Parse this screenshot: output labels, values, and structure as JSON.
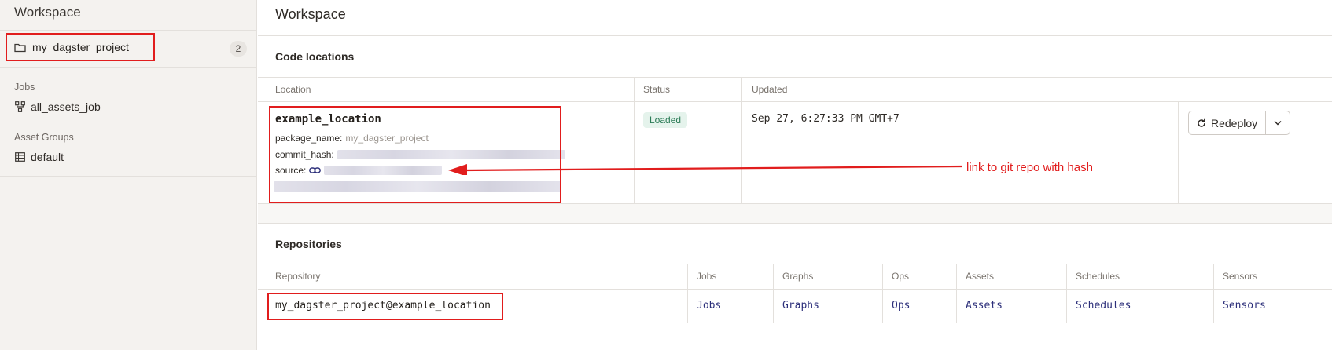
{
  "sidebar": {
    "title": "Workspace",
    "location": {
      "name": "my_dagster_project",
      "count": "2"
    },
    "jobs_label": "Jobs",
    "jobs": [
      "all_assets_job"
    ],
    "asset_groups_label": "Asset Groups",
    "asset_groups": [
      "default"
    ]
  },
  "main": {
    "title": "Workspace",
    "code_locations": {
      "title": "Code locations",
      "headers": {
        "location": "Location",
        "status": "Status",
        "updated": "Updated"
      },
      "row": {
        "name": "example_location",
        "package_key": "package_name:",
        "package_value": "my_dagster_project",
        "commit_key": "commit_hash:",
        "source_key": "source:",
        "status": "Loaded",
        "updated": "Sep 27, 6:27:33 PM GMT+7",
        "redeploy_label": "Redeploy"
      }
    },
    "repositories": {
      "title": "Repositories",
      "headers": [
        "Repository",
        "Jobs",
        "Graphs",
        "Ops",
        "Assets",
        "Schedules",
        "Sensors"
      ],
      "row": {
        "name": "my_dagster_project@example_location",
        "links": [
          "Jobs",
          "Graphs",
          "Ops",
          "Assets",
          "Schedules",
          "Sensors"
        ]
      }
    }
  },
  "annotation": {
    "text": "link to git repo with hash",
    "color": "#e11d1d"
  },
  "colors": {
    "accent_link": "#2c2f7a",
    "status_green": "#2b7b56",
    "sidebar_bg": "#f4f2ef"
  }
}
